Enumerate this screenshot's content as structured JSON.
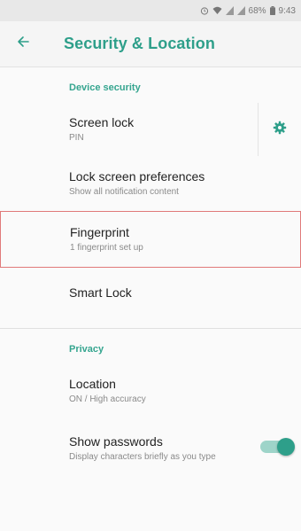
{
  "status_bar": {
    "battery": "68%",
    "time": "9:43",
    "icons": [
      "alarm-icon",
      "wifi-icon",
      "signal-icon",
      "signal-icon",
      "battery-icon"
    ]
  },
  "toolbar": {
    "title": "Security & Location",
    "back_icon": "arrow-back-icon"
  },
  "sections": {
    "device_security": {
      "header": "Device security",
      "screen_lock": {
        "title": "Screen lock",
        "summary": "PIN",
        "settings_icon": "gear-icon"
      },
      "lock_prefs": {
        "title": "Lock screen preferences",
        "summary": "Show all notification content"
      },
      "fingerprint": {
        "title": "Fingerprint",
        "summary": "1 fingerprint set up"
      },
      "smart_lock": {
        "title": "Smart Lock"
      }
    },
    "privacy": {
      "header": "Privacy",
      "location": {
        "title": "Location",
        "summary": "ON / High accuracy"
      },
      "show_passwords": {
        "title": "Show passwords",
        "summary": "Display characters briefly as you type",
        "enabled": true
      }
    }
  },
  "colors": {
    "accent": "#2e9f8a",
    "highlight_border": "#e07a7a"
  }
}
